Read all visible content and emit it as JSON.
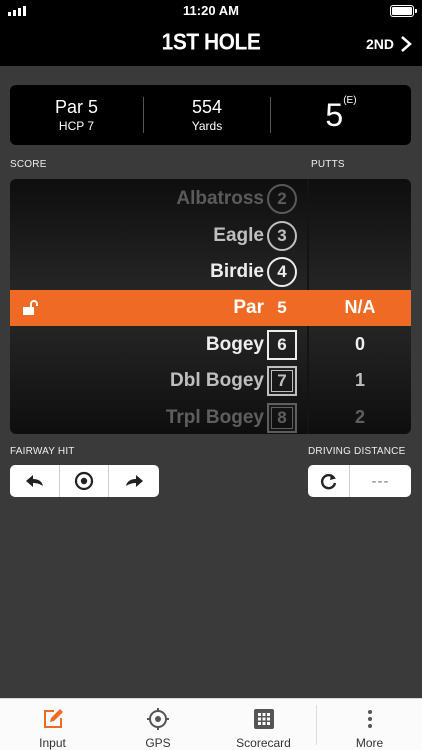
{
  "status": {
    "time": "11:20 AM"
  },
  "nav": {
    "title": "1ST HOLE",
    "next_label": "2ND"
  },
  "hole": {
    "par": "Par 5",
    "hcp": "HCP 7",
    "yards_value": "554",
    "yards_label": "Yards",
    "score": "5",
    "score_rel": "(E)"
  },
  "labels": {
    "score": "SCORE",
    "putts": "PUTTS",
    "fairway_hit": "FAIRWAY HIT",
    "driving_distance": "DRIVING DISTANCE"
  },
  "score_rows": [
    {
      "name": "Albatross",
      "num": "2",
      "putts": ""
    },
    {
      "name": "Eagle",
      "num": "3",
      "putts": ""
    },
    {
      "name": "Birdie",
      "num": "4",
      "putts": ""
    },
    {
      "name": "Par",
      "num": "5",
      "putts": "N/A"
    },
    {
      "name": "Bogey",
      "num": "6",
      "putts": "0"
    },
    {
      "name": "Dbl Bogey",
      "num": "7",
      "putts": "1"
    },
    {
      "name": "Trpl Bogey",
      "num": "8",
      "putts": "2"
    }
  ],
  "driving_distance": {
    "value": "---"
  },
  "tabs": [
    {
      "label": "Input",
      "icon": "edit-icon"
    },
    {
      "label": "GPS",
      "icon": "crosshair-icon"
    },
    {
      "label": "Scorecard",
      "icon": "grid-icon"
    },
    {
      "label": "More",
      "icon": "more-vertical-icon"
    }
  ],
  "colors": {
    "accent": "#ee6a25",
    "background": "#3a3a3a",
    "card": "#000000"
  }
}
